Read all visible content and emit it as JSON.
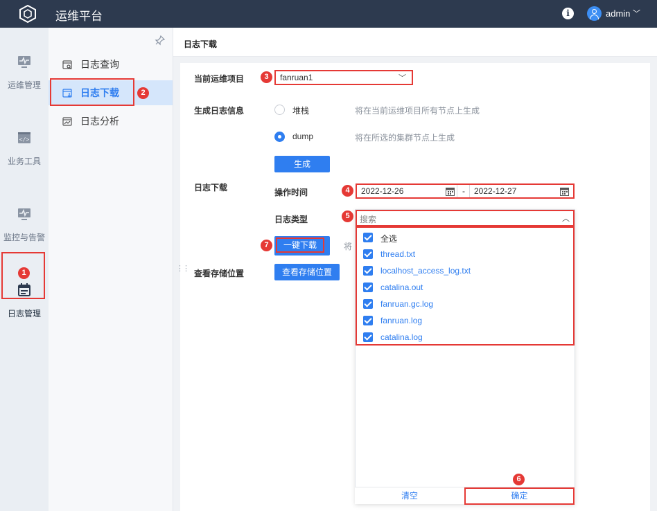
{
  "app": {
    "title": "运维平台",
    "username": "admin"
  },
  "rail": {
    "items": [
      {
        "label": "运维管理",
        "icon": "monitor-pulse-icon"
      },
      {
        "label": "业务工具",
        "icon": "code-window-icon"
      },
      {
        "label": "监控与告警",
        "icon": "monitor-alert-icon"
      },
      {
        "label": "日志管理",
        "icon": "log-calendar-icon"
      }
    ]
  },
  "subnav": {
    "items": [
      {
        "label": "日志查询",
        "icon": "log-search-icon"
      },
      {
        "label": "日志下载",
        "icon": "log-download-icon"
      },
      {
        "label": "日志分析",
        "icon": "log-analysis-icon"
      }
    ]
  },
  "page": {
    "header": "日志下载",
    "project_label": "当前运维项目",
    "project_value": "fanruan1",
    "gen_label": "生成日志信息",
    "radio_stack": "堆栈",
    "radio_stack_hint": "将在当前运维项目所有节点上生成",
    "radio_dump": "dump",
    "radio_dump_hint": "将在所选的集群节点上生成",
    "generate_btn": "生成",
    "download_label": "日志下载",
    "op_time_label": "操作时间",
    "date_start": "2022-12-26",
    "date_sep": "-",
    "date_end": "2022-12-27",
    "log_type_label": "日志类型",
    "search_placeholder": "搜索",
    "download_btn": "一键下载",
    "download_hint": "将",
    "storage_label": "查看存储位置",
    "storage_btn": "查看存储位置",
    "options": [
      "全选",
      "thread.txt",
      "localhost_access_log.txt",
      "catalina.out",
      "fanruan.gc.log",
      "fanruan.log",
      "catalina.log"
    ],
    "clear_btn": "清空",
    "ok_btn": "确定"
  },
  "badges": [
    "1",
    "2",
    "3",
    "4",
    "5",
    "6",
    "7"
  ],
  "colors": {
    "topbar": "#2d3a4f",
    "accent": "#2f7ef0",
    "highlight": "#e53935"
  }
}
